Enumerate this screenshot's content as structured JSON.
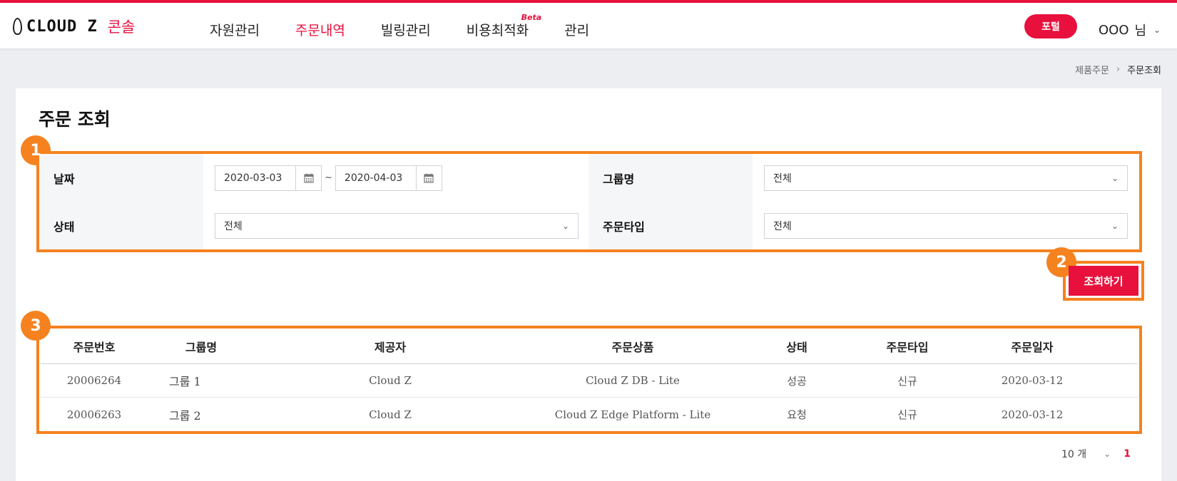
{
  "header": {
    "logo_text": "CLOUD Z",
    "logo_console": "콘솔",
    "nav": [
      {
        "label": "자원관리"
      },
      {
        "label": "주문내역"
      },
      {
        "label": "빌링관리"
      },
      {
        "label": "비용최적화",
        "badge": "Beta"
      },
      {
        "label": "관리"
      }
    ],
    "active_nav_index": 1,
    "portal_label": "포털",
    "user_name": "OOO",
    "user_suffix": "님"
  },
  "breadcrumb": {
    "parent": "제품주문",
    "current": "주문조회"
  },
  "page_title": "주문 조회",
  "filter": {
    "date_label": "날짜",
    "date_from": "2020-03-03",
    "date_sep": "~",
    "date_to": "2020-04-03",
    "group_label": "그룹명",
    "group_value": "전체",
    "status_label": "상태",
    "status_value": "전체",
    "order_type_label": "주문타입",
    "order_type_value": "전체"
  },
  "search_label": "조회하기",
  "callouts": [
    "1",
    "2",
    "3"
  ],
  "table": {
    "columns": [
      "주문번호",
      "그룹명",
      "제공자",
      "주문상품",
      "상태",
      "주문타입",
      "주문일자"
    ],
    "rows": [
      [
        "20006264",
        "그룹 1",
        "Cloud Z",
        "Cloud Z DB - Lite",
        "성공",
        "신규",
        "2020-03-12"
      ],
      [
        "20006263",
        "그룹 2",
        "Cloud Z",
        "Cloud Z Edge Platform - Lite",
        "요청",
        "신규",
        "2020-03-12"
      ]
    ]
  },
  "pager": {
    "page_size": "10 개",
    "current_page": "1"
  },
  "colors": {
    "accent": "#e8103d",
    "callout": "#f5821f"
  }
}
